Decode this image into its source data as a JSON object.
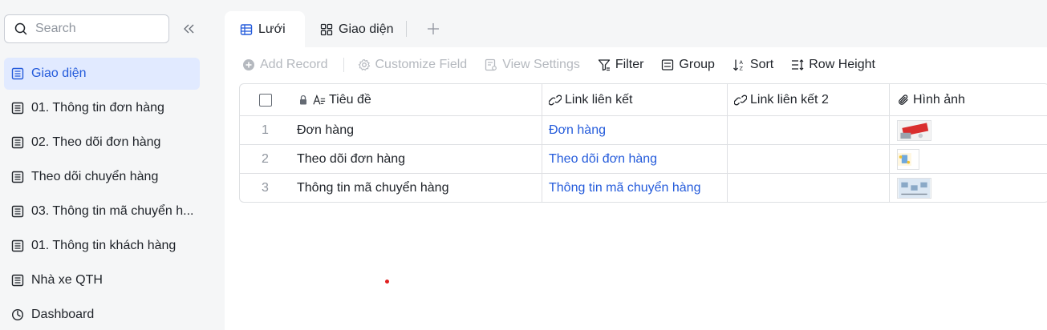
{
  "search": {
    "placeholder": "Search"
  },
  "sidebar": {
    "items": [
      {
        "label": "Giao diện",
        "icon": "grid-icon",
        "active": true
      },
      {
        "label": "01. Thông tin đơn hàng",
        "icon": "grid-icon"
      },
      {
        "label": "02. Theo dõi đơn hàng",
        "icon": "grid-icon"
      },
      {
        "label": "Theo dõi chuyển hàng",
        "icon": "grid-icon"
      },
      {
        "label": "03. Thông tin mã chuyển h...",
        "icon": "grid-icon"
      },
      {
        "label": "01. Thông tin khách hàng",
        "icon": "grid-icon"
      },
      {
        "label": "Nhà xe QTH",
        "icon": "grid-icon"
      },
      {
        "label": "Dashboard",
        "icon": "dashboard-icon"
      }
    ]
  },
  "tabs": [
    {
      "label": "Lưới",
      "icon": "grid-view-icon",
      "active": true
    },
    {
      "label": "Giao diện",
      "icon": "gallery-view-icon"
    }
  ],
  "toolbar": {
    "add_record": "Add Record",
    "customize_field": "Customize Field",
    "view_settings": "View Settings",
    "filter": "Filter",
    "group": "Group",
    "sort": "Sort",
    "row_height": "Row Height"
  },
  "table": {
    "columns": [
      "Tiêu đề",
      "Link liên kết",
      "Link liên kết 2",
      "Hình ảnh"
    ],
    "rows": [
      {
        "index": "1",
        "title": "Đơn hàng",
        "link": "Đơn hàng",
        "link2": ""
      },
      {
        "index": "2",
        "title": "Theo dõi đơn hàng",
        "link": "Theo dõi đơn hàng",
        "link2": ""
      },
      {
        "index": "3",
        "title": "Thông tin mã chuyển hàng",
        "link": "Thông tin mã chuyển hàng",
        "link2": ""
      }
    ]
  },
  "colors": {
    "accent": "#245bdb",
    "active_bg": "#e1eaff",
    "border": "#dee0e3"
  }
}
